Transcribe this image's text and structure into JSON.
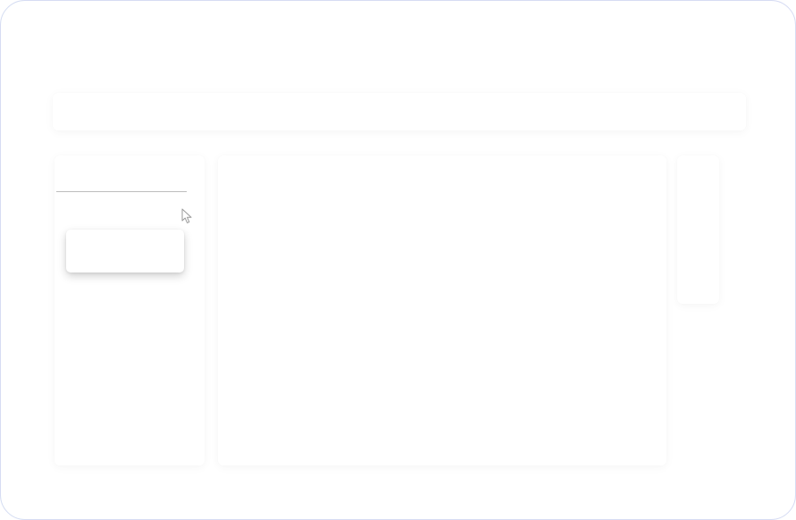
{
  "topbar": {
    "title": ""
  },
  "sidebar": {
    "search": {
      "value": "",
      "placeholder": ""
    },
    "dropdown": {
      "text": ""
    }
  },
  "main": {
    "content": ""
  },
  "rightpanel": {
    "content": ""
  },
  "icons": {
    "pointer": "mouse-pointer-icon"
  },
  "colors": {
    "frame_border": "#d6dcf3",
    "underline": "#bdbdbd",
    "background": "#ffffff"
  }
}
